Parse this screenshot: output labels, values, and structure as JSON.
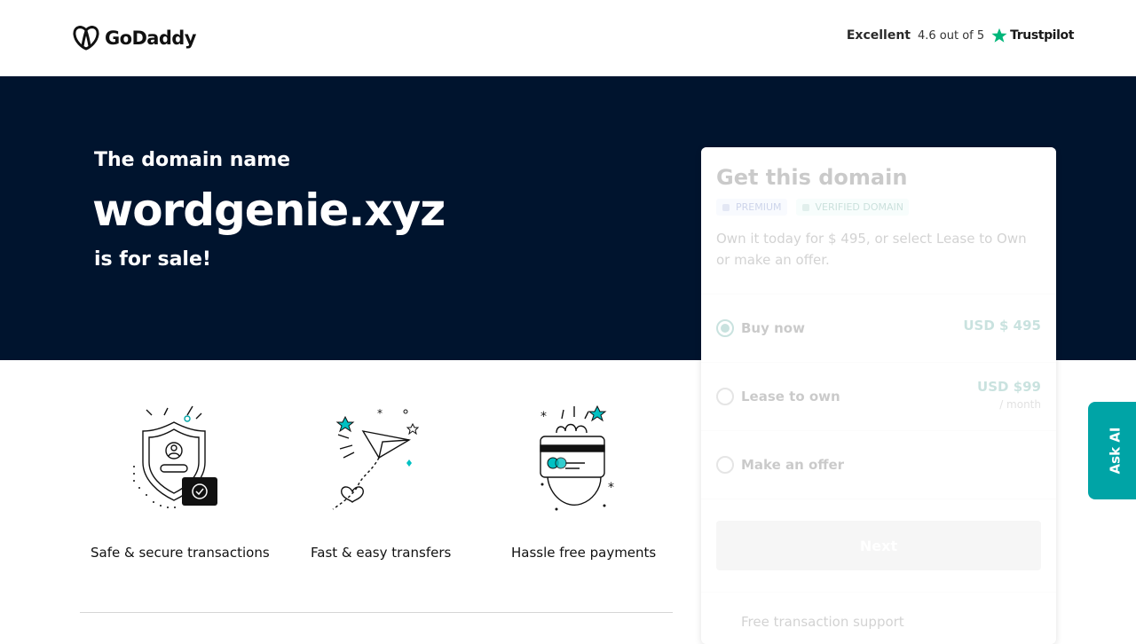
{
  "header": {
    "logo_text": "GoDaddy",
    "rating_label": "Excellent",
    "rating_score": "4.6 out of 5",
    "trustpilot": "Trustpilot"
  },
  "hero": {
    "subtitle": "The domain name",
    "domain": "wordgenie.xyz",
    "tagline": "is for sale!"
  },
  "features": [
    {
      "label": "Safe & secure transactions",
      "icon": "shield-user-icon"
    },
    {
      "label": "Fast & easy transfers",
      "icon": "paper-plane-icon"
    },
    {
      "label": "Hassle free payments",
      "icon": "card-hand-icon"
    }
  ],
  "card": {
    "title": "Get this domain",
    "badge_premium": "PREMIUM",
    "badge_verified": "VERIFIED DOMAIN",
    "description": "Own it today for $ 495, or select Lease to Own or make an offer.",
    "options": [
      {
        "label": "Buy now",
        "price": "USD $ 495",
        "sub": "",
        "selected": true
      },
      {
        "label": "Lease to own",
        "price": "USD $99",
        "sub": "/ month",
        "selected": false
      },
      {
        "label": "Make an offer",
        "price": "",
        "sub": "",
        "selected": false
      }
    ],
    "next_label": "Next",
    "support": "Free transaction support"
  },
  "ask_ai": "Ask AI",
  "colors": {
    "hero_bg": "#00142e",
    "accent": "#0a7d6c",
    "ask_ai": "#00a4a6"
  }
}
